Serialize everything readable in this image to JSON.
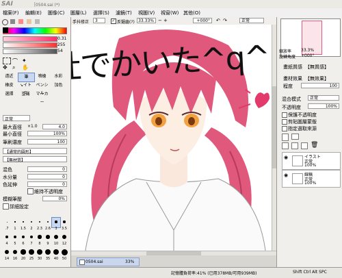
{
  "app": {
    "logo": "SAI",
    "title": "［0504.sai (*)"
  },
  "menu": [
    "檔案(F)",
    "編輯(E)",
    "圖像(C)",
    "圖層(L)",
    "選擇(S)",
    "濾鏡(T)",
    "視圖(V)",
    "視窗(W)",
    "其他(O)"
  ],
  "toolbar": {
    "hand_tremor_label": "手抖修正",
    "hand_tremor_value": "3",
    "antialias_label": "反鋸齒(?)",
    "zoom": "33.33%",
    "rotation": "+000°",
    "blend": "正常"
  },
  "left": {
    "hsv": [
      {
        "value": "0.31"
      },
      {
        "value": "255"
      },
      {
        "value": "54"
      }
    ],
    "tools": [
      "遠近",
      "筆",
      "噴槍",
      "水彩",
      "橡皮",
      "↘イトス",
      "ペンシル",
      "加色",
      "選擇",
      "塗滿",
      "マーカー"
    ],
    "mode": "正常",
    "max_diameter_label": "最大直徑",
    "max_diameter_mult": "×1.0",
    "max_diameter_value": "4.0",
    "min_diameter_label": "最小直徑",
    "min_diameter_value": "100%",
    "density_label": "筆刷濃度",
    "density_value": "100",
    "shape_label": "【通常的圓形】",
    "texture_label": "【無材質】",
    "blend_label": "混色",
    "blend_value": "0",
    "water_label": "水分量",
    "water_value": "0",
    "color_extend_label": "色延伸",
    "color_extend_value": "0",
    "keep_opacity_label": "維持不透明度",
    "blur_label": "模糊筆壓",
    "blur_value": "0%",
    "detail_label": "詳細設定",
    "brush_sizes": [
      ".7",
      "1",
      "1.5",
      "2",
      "2.3",
      "2.6",
      "3",
      "3.5",
      "4",
      "5",
      "6",
      "7",
      "8",
      "9",
      "10",
      "12",
      "14",
      "16",
      "20",
      "25",
      "30",
      "35",
      "40",
      "50"
    ]
  },
  "right": {
    "zoom_label": "縮放率",
    "zoom_value": "33.3%",
    "angle_label": "旋轉角度",
    "angle_value": "+000°",
    "paper_tex_label": "畫紙質感",
    "paper_tex_value": "【無質感】",
    "paper_eff_label": "畫材效果",
    "paper_eff_value": "【無效果】",
    "strength_label": "程度",
    "strength_value": "100",
    "blend_mode_label": "混合模式",
    "blend_mode_value": "正常",
    "opacity_label": "不透明度",
    "opacity_value": "100%",
    "checks": [
      "保護不透明度",
      "剪貼圖層蒙版",
      "指定選取來源"
    ],
    "layers": [
      {
        "name": "イラスト",
        "mode": "正常",
        "opacity": "100%"
      },
      {
        "name": "線稿",
        "mode": "正常",
        "opacity": "100%"
      }
    ]
  },
  "canvas": {
    "handwriting": "会社でかいた^q^"
  },
  "doc_tab": {
    "name": "0504.sai",
    "zoom": "33%"
  },
  "status": {
    "memory": "記憶體負荷率:41% (已用378MB/可用939MB)",
    "keys": "Shift Ctrl Alt SPC"
  }
}
